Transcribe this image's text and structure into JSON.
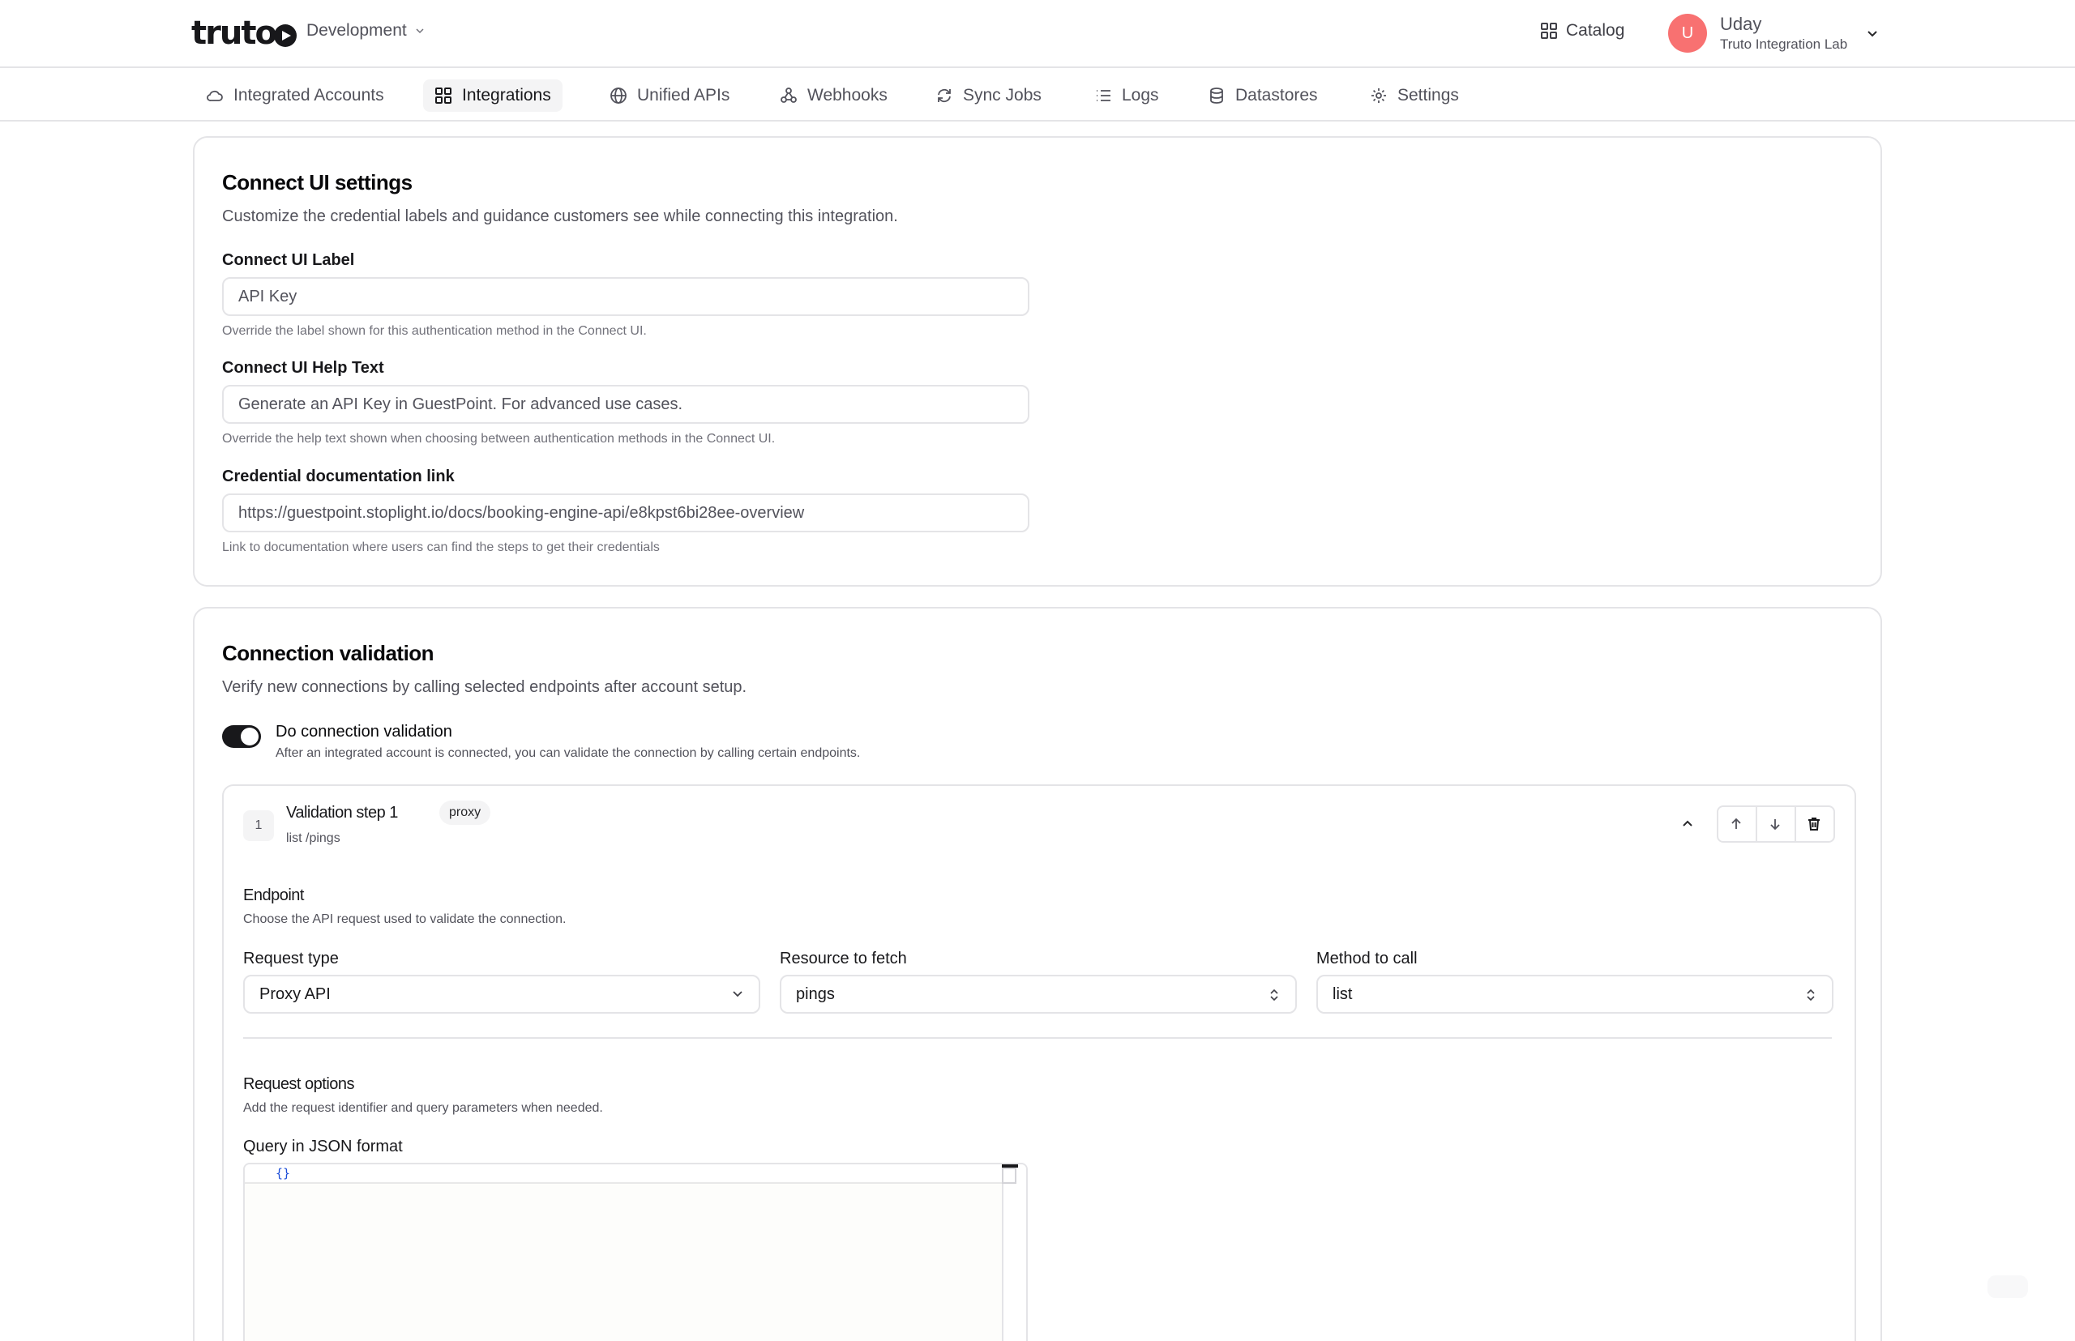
{
  "header": {
    "logo_text": "truto",
    "environment": "Development",
    "catalog_label": "Catalog",
    "user": {
      "initial": "U",
      "name": "Uday",
      "org": "Truto Integration Lab",
      "avatar_color": "#f87171"
    }
  },
  "nav": {
    "tabs": [
      {
        "label": "Integrated Accounts",
        "icon": "cloud-icon"
      },
      {
        "label": "Integrations",
        "icon": "grid-icon",
        "active": true
      },
      {
        "label": "Unified APIs",
        "icon": "globe-icon"
      },
      {
        "label": "Webhooks",
        "icon": "webhook-icon"
      },
      {
        "label": "Sync Jobs",
        "icon": "sync-icon"
      },
      {
        "label": "Logs",
        "icon": "list-icon"
      },
      {
        "label": "Datastores",
        "icon": "database-icon"
      },
      {
        "label": "Settings",
        "icon": "gear-icon"
      }
    ]
  },
  "connect_ui": {
    "title": "Connect UI settings",
    "description": "Customize the credential labels and guidance customers see while connecting this integration.",
    "label_field": {
      "label": "Connect UI Label",
      "value": "API Key",
      "help": "Override the label shown for this authentication method in the Connect UI."
    },
    "help_field": {
      "label": "Connect UI Help Text",
      "value": "Generate an API Key in GuestPoint. For advanced use cases.",
      "help": "Override the help text shown when choosing between authentication methods in the Connect UI."
    },
    "doc_field": {
      "label": "Credential documentation link",
      "value": "https://guestpoint.stoplight.io/docs/booking-engine-api/e8kpst6bi28ee-overview",
      "help": "Link to documentation where users can find the steps to get their credentials"
    }
  },
  "validation": {
    "title": "Connection validation",
    "description": "Verify new connections by calling selected endpoints after account setup.",
    "toggle": {
      "label": "Do connection validation",
      "help": "After an integrated account is connected, you can validate the connection by calling certain endpoints.",
      "enabled": true
    },
    "step": {
      "number": "1",
      "title": "Validation step 1",
      "badge": "proxy",
      "subtitle": "list /pings",
      "endpoint_title": "Endpoint",
      "endpoint_desc": "Choose the API request used to validate the connection.",
      "request_type_label": "Request type",
      "request_type_value": "Proxy API",
      "resource_label": "Resource to fetch",
      "resource_value": "pings",
      "method_label": "Method to call",
      "method_value": "list",
      "options_title": "Request options",
      "options_desc": "Add the request identifier and query parameters when needed.",
      "query_label": "Query in JSON format",
      "query_value": "{}"
    }
  }
}
